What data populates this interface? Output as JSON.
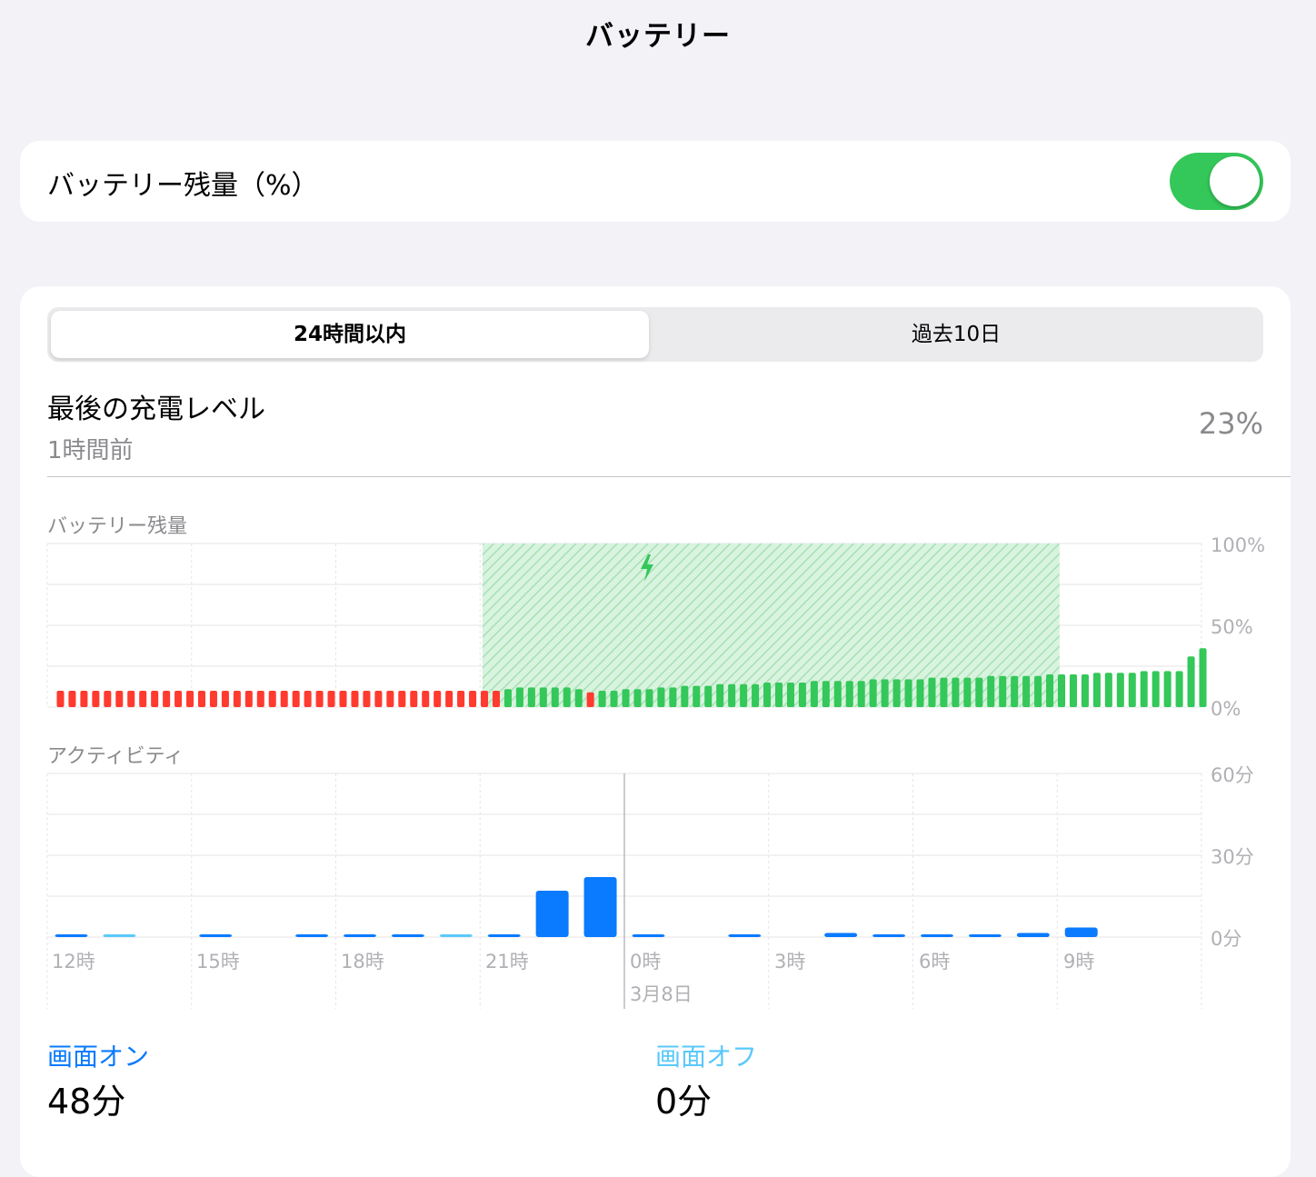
{
  "header": {
    "title": "バッテリー"
  },
  "battery_percentage": {
    "label": "バッテリー残量（%）",
    "enabled": true
  },
  "tabs": [
    {
      "label": "24時間以内",
      "selected": true
    },
    {
      "label": "過去10日",
      "selected": false
    }
  ],
  "last_charge": {
    "title": "最後の充電レベル",
    "time": "1時間前",
    "value": "23%"
  },
  "battery_chart": {
    "label": "バッテリー残量",
    "y_ticks": [
      "100%",
      "50%",
      "0%"
    ],
    "charging_icon": "bolt-icon"
  },
  "activity_chart": {
    "label": "アクティビティ",
    "y_ticks": [
      "60分",
      "30分",
      "0分"
    ],
    "x_ticks": [
      "12時",
      "15時",
      "18時",
      "21時",
      "0時",
      "3時",
      "6時",
      "9時"
    ],
    "date_label": "3月8日"
  },
  "screen_on": {
    "label": "画面オン",
    "value": "48分"
  },
  "screen_off": {
    "label": "画面オフ",
    "value": "0分"
  },
  "colors": {
    "green": "#34c759",
    "red": "#ff3b30",
    "screen_on": "#0a7aff",
    "screen_off": "#5ac8fa",
    "muted": "#8a8a8e"
  },
  "chart_data": [
    {
      "type": "bar",
      "title": "バッテリー残量",
      "ylim": [
        0,
        100
      ],
      "y_unit": "%",
      "x_start": "12時",
      "x_end": "12時",
      "charging_ranges": [
        [
          37.7,
          87.7
        ]
      ],
      "values": [
        10,
        10,
        10,
        10,
        10,
        10,
        10,
        10,
        10,
        10,
        10,
        10,
        10,
        10,
        10,
        10,
        10,
        10,
        10,
        10,
        10,
        10,
        10,
        10,
        10,
        10,
        10,
        10,
        10,
        10,
        10,
        10,
        10,
        10,
        10,
        10,
        10,
        10,
        11,
        12,
        12,
        12,
        12,
        12,
        11,
        9,
        10,
        10,
        11,
        11,
        11,
        12,
        12,
        13,
        13,
        13,
        14,
        14,
        14,
        14,
        15,
        15,
        15,
        15,
        16,
        16,
        16,
        16,
        16,
        17,
        17,
        17,
        17,
        17,
        18,
        18,
        18,
        18,
        18,
        19,
        19,
        19,
        19,
        19,
        20,
        20,
        20,
        20,
        21,
        21,
        21,
        21,
        22,
        22,
        22,
        22,
        31,
        36
      ],
      "states": [
        "low",
        "low",
        "low",
        "low",
        "low",
        "low",
        "low",
        "low",
        "low",
        "low",
        "low",
        "low",
        "low",
        "low",
        "low",
        "low",
        "low",
        "low",
        "low",
        "low",
        "low",
        "low",
        "low",
        "low",
        "low",
        "low",
        "low",
        "low",
        "low",
        "low",
        "low",
        "low",
        "low",
        "low",
        "low",
        "low",
        "low",
        "low",
        "charge",
        "charge",
        "charge",
        "charge",
        "charge",
        "charge",
        "charge",
        "low",
        "charge",
        "charge",
        "charge",
        "charge",
        "charge",
        "charge",
        "charge",
        "charge",
        "charge",
        "charge",
        "charge",
        "charge",
        "charge",
        "charge",
        "charge",
        "charge",
        "charge",
        "charge",
        "charge",
        "charge",
        "charge",
        "charge",
        "charge",
        "charge",
        "charge",
        "charge",
        "charge",
        "charge",
        "charge",
        "charge",
        "charge",
        "charge",
        "charge",
        "charge",
        "charge",
        "charge",
        "charge",
        "charge",
        "charge",
        "charge",
        "charge",
        "charge",
        "charge",
        "charge",
        "charge",
        "charge",
        "charge",
        "charge",
        "charge",
        "charge",
        "charge",
        "charge"
      ]
    },
    {
      "type": "bar",
      "title": "アクティビティ",
      "ylim": [
        0,
        60
      ],
      "y_unit": "分",
      "categories": [
        "12時",
        "13時",
        "14時",
        "15時",
        "16時",
        "17時",
        "18時",
        "19時",
        "20時",
        "21時",
        "22時",
        "23時",
        "0時",
        "1時",
        "2時",
        "3時",
        "4時",
        "5時",
        "6時",
        "7時",
        "8時",
        "9時",
        "10時",
        "11時"
      ],
      "series": [
        {
          "name": "画面オン",
          "values": [
            0.5,
            0,
            0,
            0.5,
            0,
            0.5,
            0.5,
            0.5,
            0,
            0.5,
            17,
            22,
            0.5,
            0,
            0.5,
            0,
            1.5,
            0.5,
            0.5,
            0.5,
            1.5,
            3.5,
            0,
            0
          ]
        },
        {
          "name": "画面オフ",
          "values": [
            0,
            0.5,
            0,
            0,
            0,
            0,
            0,
            0,
            0.5,
            0,
            0,
            0,
            0,
            0,
            0,
            0,
            0,
            0,
            0,
            0,
            0,
            0,
            0,
            0
          ]
        }
      ]
    }
  ]
}
